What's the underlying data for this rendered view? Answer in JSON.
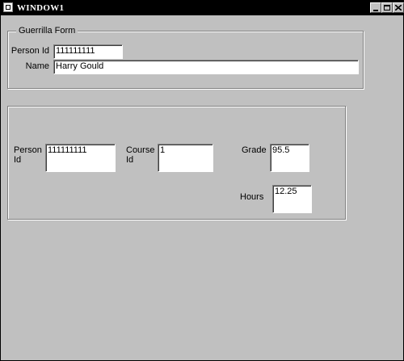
{
  "window": {
    "title": "WINDOW1"
  },
  "guerrilla_form": {
    "legend": "Guerrilla Form",
    "person_id_label": "Person Id",
    "person_id_value": "111111111",
    "name_label": "Name",
    "name_value": "Harry Gould"
  },
  "enrollment": {
    "person_id_label_line1": "Person",
    "person_id_label_line2": "Id",
    "person_id_value": "111111111",
    "course_id_label_line1": "Course",
    "course_id_label_line2": "Id",
    "course_id_value": "1",
    "grade_label": "Grade",
    "grade_value": "95.5",
    "hours_label": "Hours",
    "hours_value": "12.25"
  },
  "icons": {
    "window_icon": "app-window-icon",
    "minimize": "minimize-icon",
    "maximize": "maximize-icon",
    "close": "close-icon"
  }
}
